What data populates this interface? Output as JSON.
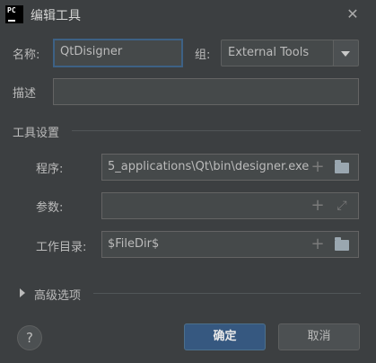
{
  "window": {
    "title": "编辑工具",
    "app_icon_text": "PC",
    "close_icon": "close-icon"
  },
  "form": {
    "name_label": "名称:",
    "name_value": "QtDisigner",
    "group_label": "组:",
    "group_value": "External Tools",
    "description_label": "描述",
    "description_value": ""
  },
  "tool_settings": {
    "section_title": "工具设置",
    "program_label": "程序:",
    "program_value": "5_applications\\Qt\\bin\\designer.exe",
    "arguments_label": "参数:",
    "arguments_value": "",
    "workdir_label": "工作目录:",
    "workdir_value": "$FileDir$"
  },
  "advanced": {
    "label": "高级选项"
  },
  "footer": {
    "help_label": "?",
    "ok_label": "确定",
    "cancel_label": "取消"
  },
  "icons": {
    "plus": "+",
    "folder": "folder-icon",
    "expand": "expand-icon",
    "chevron": "chevron-down-icon",
    "triangle": "triangle-right-icon"
  },
  "colors": {
    "background": "#3c3f41",
    "field_bg": "#45494a",
    "focus_border": "#3d6185",
    "primary_button": "#365880"
  }
}
